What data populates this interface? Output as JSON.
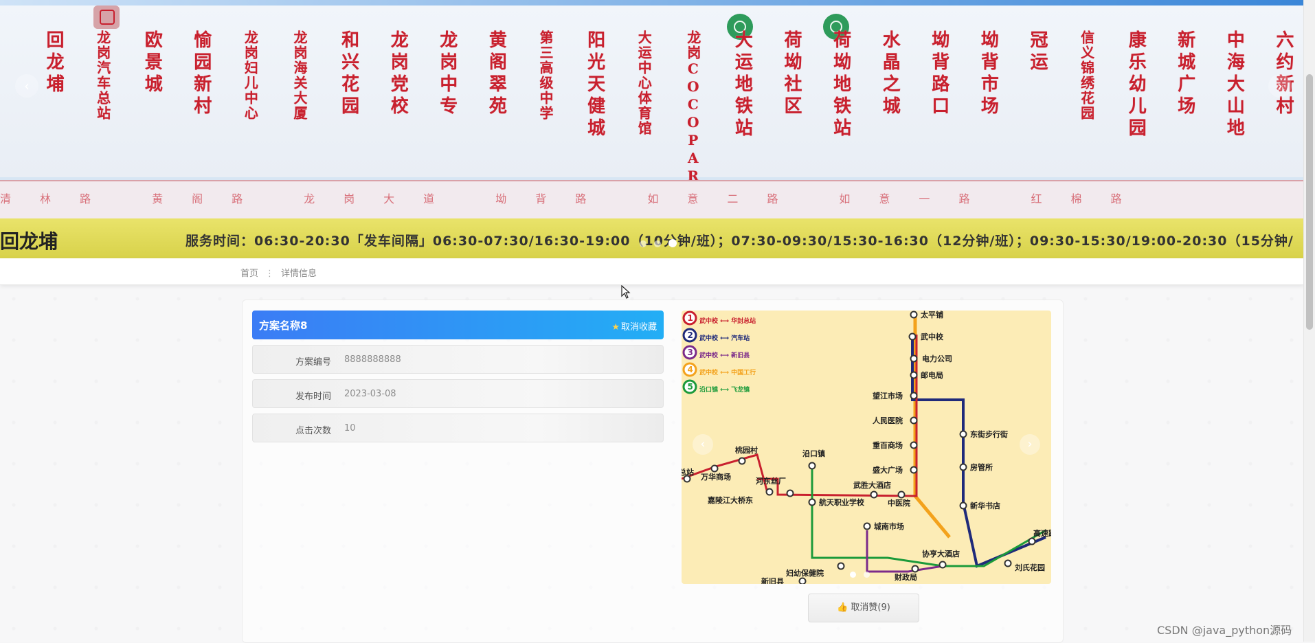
{
  "banner": {
    "stops": [
      {
        "name": "回龙埔"
      },
      {
        "name": "龙岗汽车总站"
      },
      {
        "name": "欧景城"
      },
      {
        "name": "愉园新村"
      },
      {
        "name": "龙岗妇儿中心"
      },
      {
        "name": "龙岗海关大厦"
      },
      {
        "name": "和兴花园"
      },
      {
        "name": "龙岗党校"
      },
      {
        "name": "龙岗中专"
      },
      {
        "name": "黄阁翠苑"
      },
      {
        "name": "第三高级中学"
      },
      {
        "name": "阳光天健城"
      },
      {
        "name": "大运中心体育馆"
      },
      {
        "name": "龙岗COCOPARK西"
      },
      {
        "name": "大运地铁站"
      },
      {
        "name": "荷坳社区"
      },
      {
        "name": "荷坳地铁站"
      },
      {
        "name": "水晶之城"
      },
      {
        "name": "坳背路口"
      },
      {
        "name": "坳背市场"
      },
      {
        "name": "冠运"
      },
      {
        "name": "信义锦绣花园"
      },
      {
        "name": "康乐幼儿园"
      },
      {
        "name": "新城广场"
      },
      {
        "name": "中海大山地"
      },
      {
        "name": "六约新村"
      }
    ],
    "road_text": "清林路 黄阁路 龙岗大道 坳背路 如意二路 如意一路 红棉路",
    "left_stop": "回龙埔",
    "service_text": "服务时间：06:30-20:30「发车间隔」06:30-07:30/16:30-19:00（10分钟/班）；07:30-09:30/15:30-16:30（12分钟/班）；09:30-15:30/19:00-20:30（15分钟/",
    "arrow_prev": "‹",
    "arrow_next": "›"
  },
  "breadcrumb": {
    "home": "首页",
    "separator": "⋮",
    "current": "详情信息"
  },
  "detail": {
    "title": "方案名称8",
    "favorite_label": "取消收藏",
    "favorite_icon": "star-icon",
    "fields": [
      {
        "label": "方案编号",
        "value": "8888888888"
      },
      {
        "label": "发布时间",
        "value": "2023-03-08"
      },
      {
        "label": "点击次数",
        "value": "10"
      }
    ]
  },
  "map": {
    "legend": [
      {
        "num": "1",
        "route": "武中校 ⟷ 华封总站",
        "color": "#c8202e"
      },
      {
        "num": "2",
        "route": "武中校 ⟷ 汽车站",
        "color": "#1f2a7a"
      },
      {
        "num": "3",
        "route": "武中校 ⟷ 新旧县",
        "color": "#7b2a8a"
      },
      {
        "num": "4",
        "route": "武中校 ⟷ 中国工行",
        "color": "#f3a21c"
      },
      {
        "num": "5",
        "route": "沿口镇 ⟷ 飞龙镇",
        "color": "#1b9a3a"
      }
    ],
    "stations": [
      "太平铺",
      "武中校",
      "电力公司",
      "邮电局",
      "望江市场",
      "人民医院",
      "重百商场",
      "盛大广场",
      "东街步行街",
      "房管所",
      "新华书店",
      "武胜大酒店",
      "中医院",
      "城南市场",
      "协亨大酒店",
      "财政局",
      "妇幼保健院",
      "沿口镇",
      "桃园村",
      "万华商场",
      "河东丝厂",
      "航天职业学校",
      "嘉陵江大桥东",
      "高速路口",
      "刘氏花园",
      "总站",
      "新旧县"
    ],
    "arrow_prev": "‹",
    "arrow_next": "›"
  },
  "like": {
    "label": "取消赞(9)",
    "icon": "thumbs-up-icon"
  },
  "watermark": "CSDN @java_python源码"
}
